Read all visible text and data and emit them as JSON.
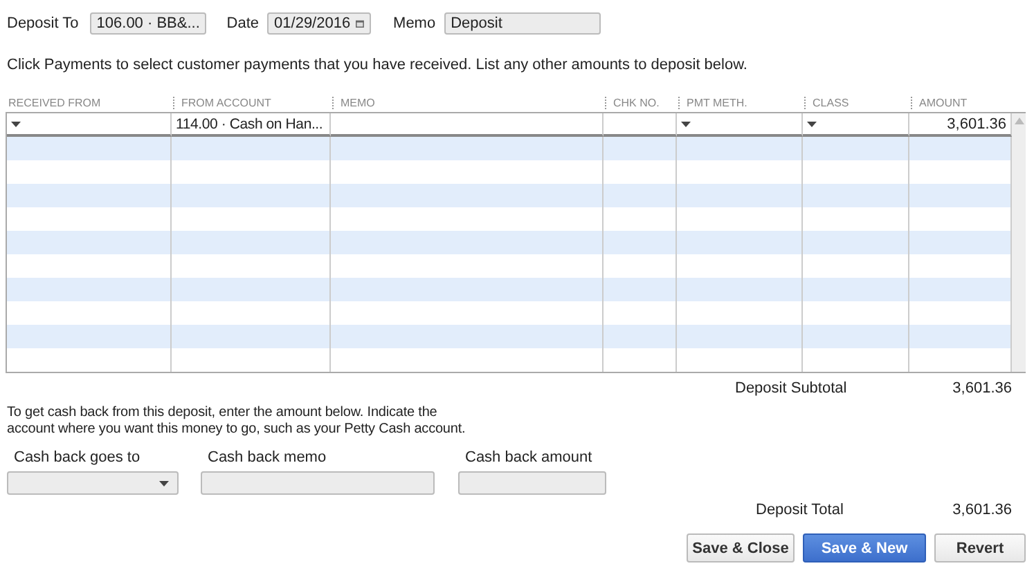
{
  "header": {
    "deposit_to": {
      "label": "Deposit To",
      "value": "106.00 · BB&..."
    },
    "date": {
      "label": "Date",
      "value": "01/29/2016"
    },
    "memo": {
      "label": "Memo",
      "value": "Deposit"
    }
  },
  "instruction": "Click Payments to select customer payments that you have received. List any other amounts to deposit below.",
  "table": {
    "columns": [
      {
        "label": "RECEIVED FROM",
        "kind": "dropdown"
      },
      {
        "label": "FROM ACCOUNT",
        "kind": "dropdown"
      },
      {
        "label": "MEMO",
        "kind": "text"
      },
      {
        "label": "CHK NO.",
        "kind": "text"
      },
      {
        "label": "PMT METH.",
        "kind": "dropdown"
      },
      {
        "label": "CLASS",
        "kind": "dropdown"
      },
      {
        "label": "AMOUNT",
        "kind": "amount"
      }
    ],
    "rows": [
      {
        "cells": [
          "",
          "114.00 · Cash on Han...",
          "",
          "",
          "",
          "",
          "3,601.36"
        ]
      }
    ]
  },
  "subtotal": {
    "label": "Deposit Subtotal",
    "value": "3,601.36"
  },
  "cash_back": {
    "text": "To get cash back from this deposit, enter the amount below.  Indicate the account where you want this money to go, such as your Petty Cash account.",
    "goes_to": {
      "label": "Cash back goes to"
    },
    "memo": {
      "label": "Cash back memo"
    },
    "amount": {
      "label": "Cash back amount"
    }
  },
  "total": {
    "label": "Deposit Total",
    "value": "3,601.36"
  },
  "buttons": [
    {
      "label": "Save & Close",
      "primary": false
    },
    {
      "label": "Save & New",
      "primary": true
    },
    {
      "label": "Revert",
      "primary": false
    }
  ]
}
